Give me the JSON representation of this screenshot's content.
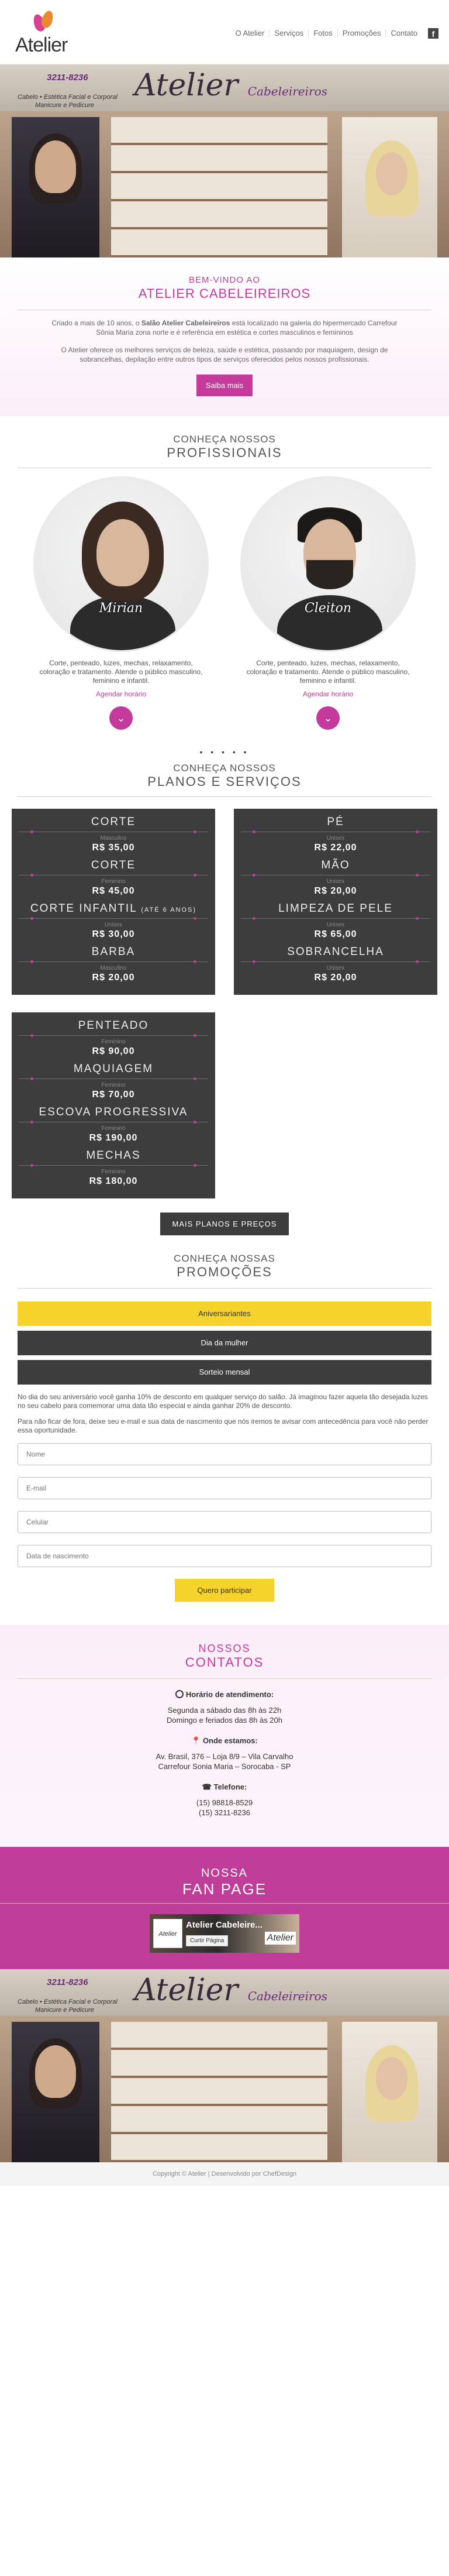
{
  "header": {
    "logo_text": "Atelier",
    "nav": [
      "O Atelier",
      "Serviços",
      "Fotos",
      "Promoções",
      "Contato"
    ],
    "social_icon": "facebook-icon"
  },
  "storefront": {
    "phone": "3211-8236",
    "brand": "Atelier",
    "brand_sub": "Cabeleireiros",
    "line1": "Cabelo • Estética Facial e Corporal",
    "line2": "Manicure e Pedicure"
  },
  "welcome": {
    "kicker": "BEM-VINDO AO",
    "title": "ATELIER CABELEIREIROS",
    "p1a": "Criado a mais de 10 anos, o ",
    "p1b": "Salão Atelier Cabeleireiros",
    "p1c": " está localizado na galeria do hipermercado Carrefour Sônia Maria zona norte e é referência em estética e cortes masculinos e femininos",
    "p2": "O Atelier oferece os melhores serviços de beleza, saúde e estética, passando por maquiagem, design de sobrancelhas, depilação entre outros tipos de serviços oferecidos pelos nossos profissionais.",
    "button": "Saiba mais"
  },
  "team": {
    "heading_small": "CONHEÇA NOSSOS",
    "heading_big": "PROFISSIONAIS",
    "members": [
      {
        "name": "Mirian",
        "desc": "Corte, penteado, luzes, mechas, relaxamento, coloração e tratamento. Atende o público masculino, feminino e infantil.",
        "link": "Agendar horário"
      },
      {
        "name": "Cleiton",
        "desc": "Corte, penteado, luzes, mechas, relaxamento, coloração e tratamento. Atende o público masculino, feminino e infantil.",
        "link": "Agendar horário"
      }
    ]
  },
  "dots": "• • • • •",
  "plans": {
    "heading_small": "CONHEÇA NOSSOS",
    "heading_big": "PLANOS E SERVIÇOS",
    "boards": [
      [
        {
          "service": "CORTE",
          "note": "",
          "tag": "Masculino",
          "price": "R$ 35,00"
        },
        {
          "service": "CORTE",
          "note": "",
          "tag": "Feminino",
          "price": "R$ 45,00"
        },
        {
          "service": "CORTE INFANTIL",
          "note": "(ATÉ 6 ANOS)",
          "tag": "Unisex",
          "price": "R$ 30,00"
        },
        {
          "service": "BARBA",
          "note": "",
          "tag": "Masculino",
          "price": "R$ 20,00"
        }
      ],
      [
        {
          "service": "PÉ",
          "note": "",
          "tag": "Unisex",
          "price": "R$ 22,00"
        },
        {
          "service": "MÃO",
          "note": "",
          "tag": "Unisex",
          "price": "R$ 20,00"
        },
        {
          "service": "LIMPEZA DE PELE",
          "note": "",
          "tag": "Unisex",
          "price": "R$ 65,00"
        },
        {
          "service": "SOBRANCELHA",
          "note": "",
          "tag": "Unisex",
          "price": "R$ 20,00"
        }
      ],
      [
        {
          "service": "PENTEADO",
          "note": "",
          "tag": "Feminino",
          "price": "R$ 90,00"
        },
        {
          "service": "MAQUIAGEM",
          "note": "",
          "tag": "Feminino",
          "price": "R$ 70,00"
        },
        {
          "service": "ESCOVA PROGRESSIVA",
          "note": "",
          "tag": "Feminino",
          "price": "R$ 190,00"
        },
        {
          "service": "MECHAS",
          "note": "",
          "tag": "Feminino",
          "price": "R$ 180,00"
        }
      ]
    ],
    "more_button": "MAIS PLANOS E PREÇOS"
  },
  "promos": {
    "heading_small": "CONHEÇA NOSSAS",
    "heading_big": "PROMOÇÕES",
    "tabs": [
      "Aniversariantes",
      "Dia da mulher",
      "Sorteio mensal"
    ],
    "text1": "No dia do seu aniversário você ganha 10% de desconto em qualquer serviço do salão. Já imaginou fazer aquela tão desejada luzes no seu cabelo para comemorar uma data tão especial e ainda ganhar 20% de desconto.",
    "text2": "Para não ficar de fora, deixe seu e-mail e sua data de nascimento que nós iremos te avisar com antecedência para você não perder essa oportunidade.",
    "fields": {
      "name": "Nome",
      "email": "E-mail",
      "phone": "Celular",
      "birth": "Data de nascimento"
    },
    "submit": "Quero participar"
  },
  "contact": {
    "kicker": "NOSSOS",
    "title": "CONTATOS",
    "hours_label": "Horário de atendimento:",
    "hours_1": "Segunda a sábado das 8h às 22h",
    "hours_2": "Domingo e feriados das 8h às 20h",
    "address_label": "Onde estamos:",
    "address_1": "Av. Brasil, 376 – Loja 8/9 – Vila Carvalho",
    "address_2": "Carrefour Sonia Maria – Sorocaba - SP",
    "phone_label": "Telefone:",
    "phone_1": "(15) 98818-8529",
    "phone_2": "(15) 3211-8236"
  },
  "fanpage": {
    "kicker": "NOSSA",
    "title": "FAN PAGE",
    "page_name": "Atelier Cabeleire...",
    "like": "Curtir Página",
    "thumb_text": "Atelier"
  },
  "footer": "Copyright © Atelier | Desenvolvido por ChefDesign"
}
